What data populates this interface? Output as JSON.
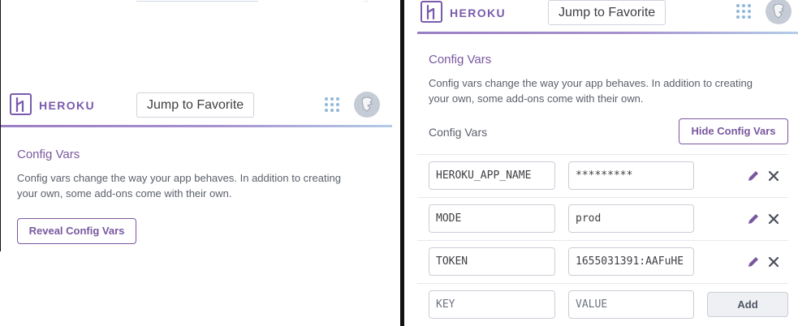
{
  "header": {
    "brand": "HEROKU",
    "jump_to_favorite": "Jump to Favorite",
    "apps_icon": "apps-grid-icon",
    "avatar_icon": "user-avatar-icon"
  },
  "left_panel": {
    "section_title": "Config Vars",
    "description_line1": "Config vars change the way your app behaves. In addition to creating",
    "description_line2": "your own, some add-ons come with their own.",
    "reveal_button": "Reveal Config Vars"
  },
  "right_panel": {
    "section_title": "Config Vars",
    "description_line1": "Config vars change the way your app behaves. In addition to creating",
    "description_line2": "your own, some add-ons come with their own.",
    "config_vars_label": "Config Vars",
    "hide_button": "Hide Config Vars",
    "vars": [
      {
        "key": "HEROKU_APP_NAME",
        "value": "*********"
      },
      {
        "key": "MODE",
        "value": "prod"
      },
      {
        "key": "TOKEN",
        "value": "1655031391:AAFuHE"
      }
    ],
    "new_var": {
      "key_placeholder": "KEY",
      "value_placeholder": "VALUE",
      "add_button": "Add"
    }
  },
  "colors": {
    "brand_purple": "#79589f",
    "header_gradient_start": "#9b7fc4",
    "header_gradient_end": "#b4cce8",
    "grid_dots": "#8fb7da"
  }
}
